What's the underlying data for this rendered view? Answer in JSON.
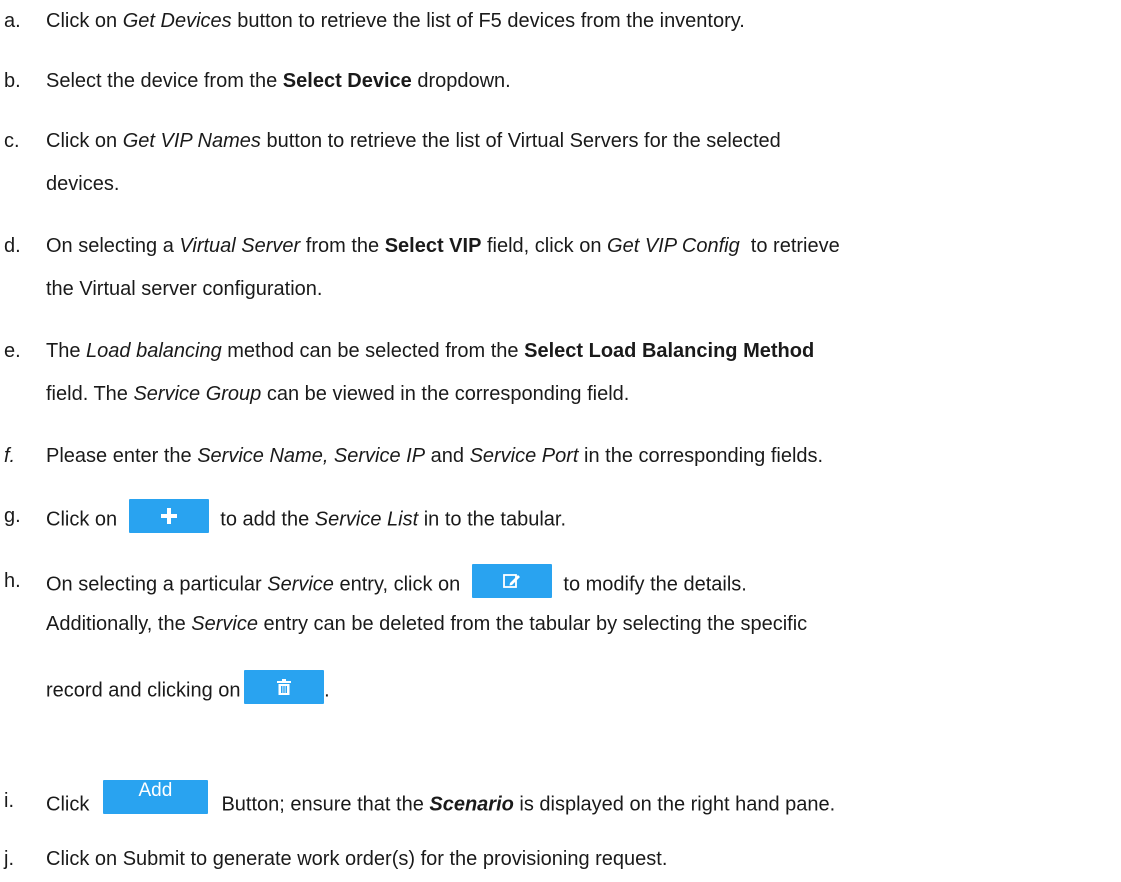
{
  "steps": [
    {
      "marker": "a.",
      "parts": [
        "Click on ",
        "Get Devices",
        " button to retrieve the list of F5 devices from the inventory."
      ]
    },
    {
      "marker": "b.",
      "parts": [
        "Select the device from the ",
        "Select Device",
        " dropdown."
      ]
    },
    {
      "marker": "c.",
      "parts": [
        "Click on ",
        "Get VIP Names",
        " button to retrieve the list of Virtual Servers for the selected",
        "devices."
      ]
    },
    {
      "marker": "d.",
      "parts": [
        "On selecting a ",
        "Virtual Server",
        " from the ",
        "Select VIP",
        " field, click on ",
        "Get VIP Config",
        "  to retrieve",
        "the Virtual server configuration."
      ]
    },
    {
      "marker": "e.",
      "parts": [
        "The ",
        "Load balancing",
        " method can be selected from the ",
        "Select Load Balancing Method",
        "field. The ",
        "Service Group",
        " can be viewed in the corresponding field."
      ]
    },
    {
      "marker": "f.",
      "parts": [
        "Please enter the ",
        "Service Name, Service IP",
        " and ",
        "Service Port",
        " in the corresponding fields."
      ]
    },
    {
      "marker": "g.",
      "parts": [
        "Click on ",
        " to add the ",
        "Service List",
        " in to the tabular."
      ]
    },
    {
      "marker": "h.",
      "parts": [
        "On selecting a particular ",
        "Service",
        " entry, click on ",
        " to modify the details.",
        "Additionally, the ",
        "Service",
        " entry can be deleted from the tabular by selecting the specific",
        "record and clicking on ",
        "."
      ]
    },
    {
      "marker": "i.",
      "parts": [
        "Click ",
        " Button; ensure that the ",
        "Scenario",
        " is displayed on the right hand pane."
      ]
    },
    {
      "marker": "j.",
      "parts": [
        "Click on Submit to generate work order(s) for the provisioning request."
      ]
    }
  ],
  "buttons": {
    "add_icon": "plus-icon",
    "edit_icon": "edit-icon",
    "delete_icon": "trash-icon",
    "add_label": "Add",
    "color": "#29a3f0"
  }
}
